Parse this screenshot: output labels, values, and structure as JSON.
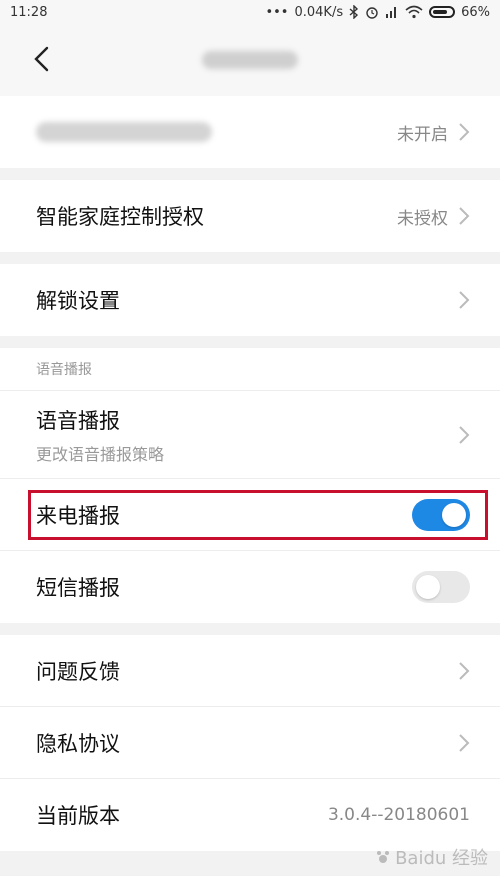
{
  "status_bar": {
    "time": "11:28",
    "dots": "•••",
    "speed": "0.04K/s",
    "battery": "66%"
  },
  "header": {
    "back_icon": "chevron-left-icon"
  },
  "rows": {
    "blurred_setting_status": "未开启",
    "smart_home_label": "智能家庭控制授权",
    "smart_home_status": "未授权",
    "unlock_label": "解锁设置"
  },
  "voice_section": {
    "header": "语音播报",
    "voice_broadcast_label": "语音播报",
    "voice_broadcast_sub": "更改语音播报策略",
    "call_broadcast_label": "来电播报",
    "call_broadcast_on": true,
    "sms_broadcast_label": "短信播报",
    "sms_broadcast_on": false
  },
  "more_section": {
    "feedback_label": "问题反馈",
    "privacy_label": "隐私协议",
    "version_label": "当前版本",
    "version_value": "3.0.4--20180601"
  },
  "colors": {
    "accent": "#1e88e5",
    "highlight": "#c8102e"
  },
  "watermark": "Baidu 经验"
}
